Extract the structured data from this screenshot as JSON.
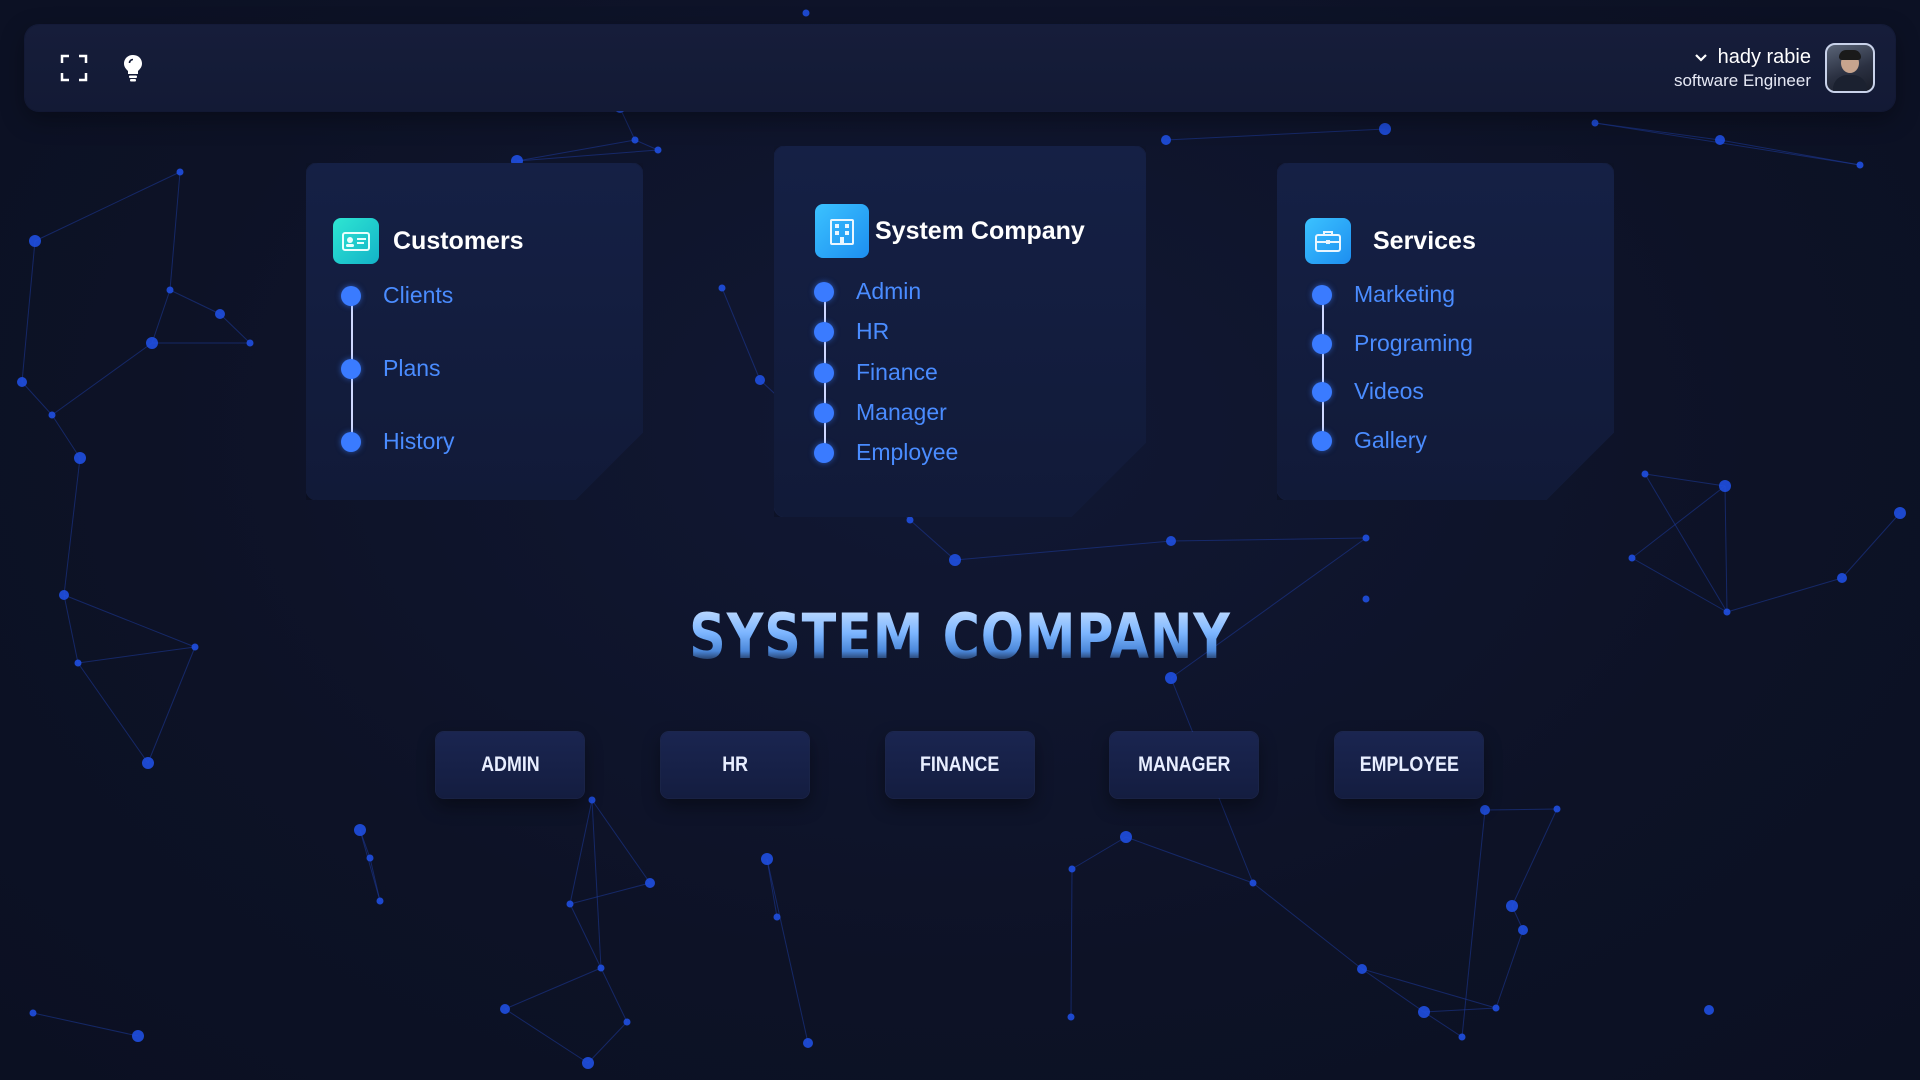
{
  "header": {
    "icons": {
      "fullscreen": "fullscreen-icon",
      "theme": "lightbulb-icon",
      "dropdown": "chevron-down-icon"
    },
    "user_name": "hady rabie",
    "user_role": "software Engineer"
  },
  "cards": [
    {
      "title": "Customers",
      "icon": "id-card-icon",
      "items": [
        "Clients",
        "Plans",
        "History"
      ]
    },
    {
      "title": "System Company",
      "icon": "building-icon",
      "items": [
        "Admin",
        "HR",
        "Finance",
        "Manager",
        "Employee"
      ]
    },
    {
      "title": "Services",
      "icon": "briefcase-icon",
      "items": [
        "Marketing",
        "Programing",
        "Videos",
        "Gallery"
      ]
    }
  ],
  "hero_title": "SYSTEM COMPANY",
  "roles": [
    "ADMIN",
    "HR",
    "FINANCE",
    "MANAGER",
    "EMPLOYEE"
  ],
  "colors": {
    "background": "#0d1226",
    "card": "#152045",
    "accent_blue": "#3a7bff",
    "link_text": "#4a8cff",
    "icon_teal": "#1fd1c9",
    "icon_blue": "#2aa8ff"
  }
}
